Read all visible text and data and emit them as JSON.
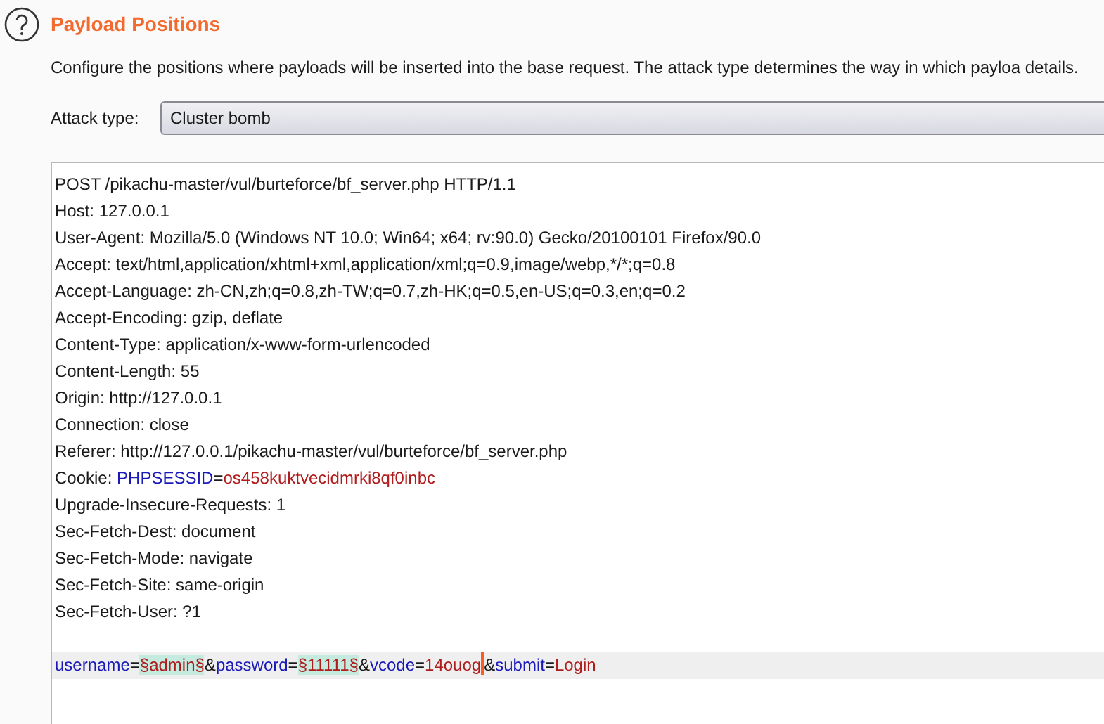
{
  "section": {
    "title": "Payload Positions",
    "description": "Configure the positions where payloads will be inserted into the base request. The attack type determines the way in which payloa details."
  },
  "attack_type": {
    "label": "Attack type:",
    "value": "Cluster bomb"
  },
  "request": {
    "lines": [
      {
        "kind": "text",
        "current": false,
        "segments": [
          {
            "kind": "text",
            "text": "POST /pikachu-master/vul/burteforce/bf_server.php HTTP/1.1"
          }
        ]
      },
      {
        "kind": "text",
        "current": false,
        "segments": [
          {
            "kind": "text",
            "text": "Host: 127.0.0.1"
          }
        ]
      },
      {
        "kind": "text",
        "current": false,
        "segments": [
          {
            "kind": "text",
            "text": "User-Agent: Mozilla/5.0 (Windows NT 10.0; Win64; x64; rv:90.0) Gecko/20100101 Firefox/90.0"
          }
        ]
      },
      {
        "kind": "text",
        "current": false,
        "segments": [
          {
            "kind": "text",
            "text": "Accept: text/html,application/xhtml+xml,application/xml;q=0.9,image/webp,*/*;q=0.8"
          }
        ]
      },
      {
        "kind": "text",
        "current": false,
        "segments": [
          {
            "kind": "text",
            "text": "Accept-Language: zh-CN,zh;q=0.8,zh-TW;q=0.7,zh-HK;q=0.5,en-US;q=0.3,en;q=0.2"
          }
        ]
      },
      {
        "kind": "text",
        "current": false,
        "segments": [
          {
            "kind": "text",
            "text": "Accept-Encoding: gzip, deflate"
          }
        ]
      },
      {
        "kind": "text",
        "current": false,
        "segments": [
          {
            "kind": "text",
            "text": "Content-Type: application/x-www-form-urlencoded"
          }
        ]
      },
      {
        "kind": "text",
        "current": false,
        "segments": [
          {
            "kind": "text",
            "text": "Content-Length: 55"
          }
        ]
      },
      {
        "kind": "text",
        "current": false,
        "segments": [
          {
            "kind": "text",
            "text": "Origin: http://127.0.0.1"
          }
        ]
      },
      {
        "kind": "text",
        "current": false,
        "segments": [
          {
            "kind": "text",
            "text": "Connection: close"
          }
        ]
      },
      {
        "kind": "text",
        "current": false,
        "segments": [
          {
            "kind": "text",
            "text": "Referer: http://127.0.0.1/pikachu-master/vul/burteforce/bf_server.php"
          }
        ]
      },
      {
        "kind": "text",
        "current": false,
        "segments": [
          {
            "kind": "text",
            "text": "Cookie: "
          },
          {
            "kind": "param",
            "text": "PHPSESSID"
          },
          {
            "kind": "text",
            "text": "="
          },
          {
            "kind": "value",
            "text": "os458kuktvecidmrki8qf0inbc"
          }
        ]
      },
      {
        "kind": "text",
        "current": false,
        "segments": [
          {
            "kind": "text",
            "text": "Upgrade-Insecure-Requests: 1"
          }
        ]
      },
      {
        "kind": "text",
        "current": false,
        "segments": [
          {
            "kind": "text",
            "text": "Sec-Fetch-Dest: document"
          }
        ]
      },
      {
        "kind": "text",
        "current": false,
        "segments": [
          {
            "kind": "text",
            "text": "Sec-Fetch-Mode: navigate"
          }
        ]
      },
      {
        "kind": "text",
        "current": false,
        "segments": [
          {
            "kind": "text",
            "text": "Sec-Fetch-Site: same-origin"
          }
        ]
      },
      {
        "kind": "text",
        "current": false,
        "segments": [
          {
            "kind": "text",
            "text": "Sec-Fetch-User: ?1"
          }
        ]
      },
      {
        "kind": "blank",
        "current": false
      },
      {
        "kind": "text",
        "current": true,
        "segments": [
          {
            "kind": "param",
            "text": "username"
          },
          {
            "kind": "text",
            "text": "="
          },
          {
            "kind": "marker",
            "text": "§admin§"
          },
          {
            "kind": "text",
            "text": "&"
          },
          {
            "kind": "param",
            "text": "password"
          },
          {
            "kind": "text",
            "text": "="
          },
          {
            "kind": "marker",
            "text": "§11111§"
          },
          {
            "kind": "text",
            "text": "&"
          },
          {
            "kind": "param",
            "text": "vcode"
          },
          {
            "kind": "text",
            "text": "="
          },
          {
            "kind": "value",
            "text": "14ouog"
          },
          {
            "kind": "cursor"
          },
          {
            "kind": "text",
            "text": "&"
          },
          {
            "kind": "param",
            "text": "submit"
          },
          {
            "kind": "text",
            "text": "="
          },
          {
            "kind": "value",
            "text": "Login"
          }
        ]
      }
    ]
  }
}
